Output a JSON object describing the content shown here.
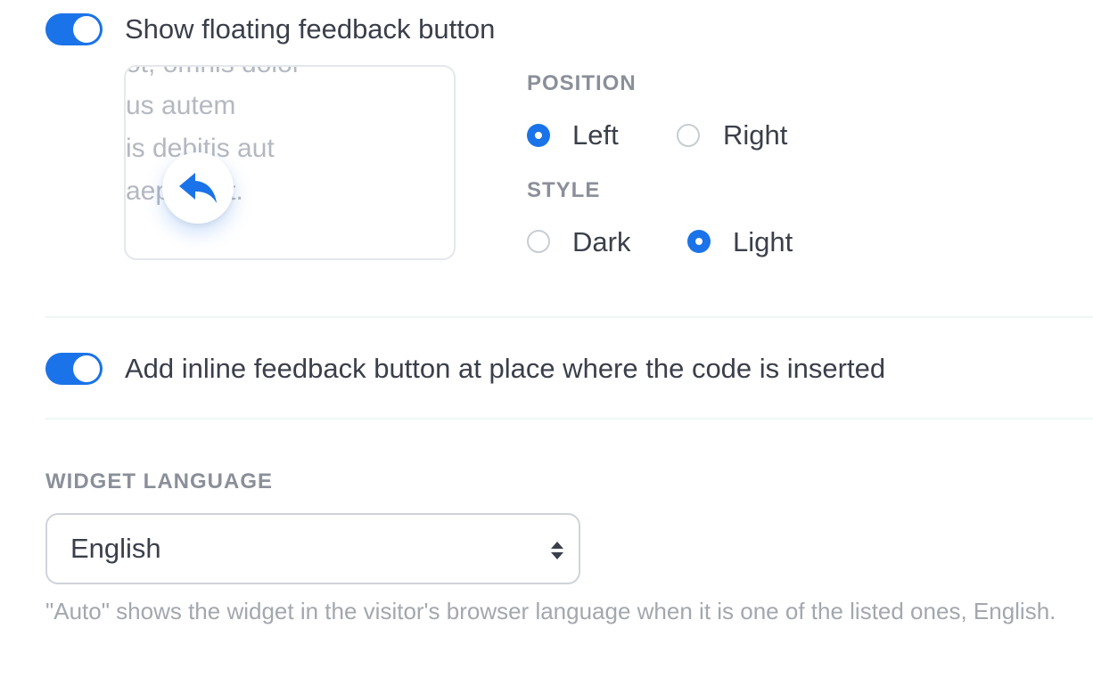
{
  "floating": {
    "toggle_on": true,
    "label": "Show floating feedback button",
    "preview_lines": [
      "ot, omnis dolor",
      "us autem",
      "is debitis aut",
      "aep  eniet."
    ],
    "position": {
      "title": "POSITION",
      "options": [
        {
          "label": "Left",
          "checked": true
        },
        {
          "label": "Right",
          "checked": false
        }
      ]
    },
    "style": {
      "title": "STYLE",
      "options": [
        {
          "label": "Dark",
          "checked": false
        },
        {
          "label": "Light",
          "checked": true
        }
      ]
    }
  },
  "inline": {
    "toggle_on": true,
    "label": "Add inline feedback button at place where the code is inserted"
  },
  "language": {
    "title": "WIDGET LANGUAGE",
    "selected": "English",
    "help": "\"Auto\" shows the widget in the visitor's browser language when it is one of the listed ones, English."
  },
  "colors": {
    "accent": "#1a73e8",
    "text": "#3b3f4a",
    "muted": "#8a8f99"
  },
  "icons": {
    "feedback": "reply-arrow-icon",
    "select": "sort-arrows-icon"
  }
}
